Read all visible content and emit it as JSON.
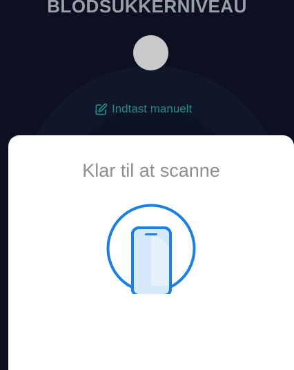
{
  "background": {
    "title": "BLODSUKKERNIVEAU",
    "manual_entry_label": "Indtast manuelt",
    "manual_entry_icon": "edit-icon"
  },
  "scan_sheet": {
    "title": "Klar til at scanne",
    "icon": "phone-scan-icon",
    "accent_color": "#1b7fe3"
  }
}
